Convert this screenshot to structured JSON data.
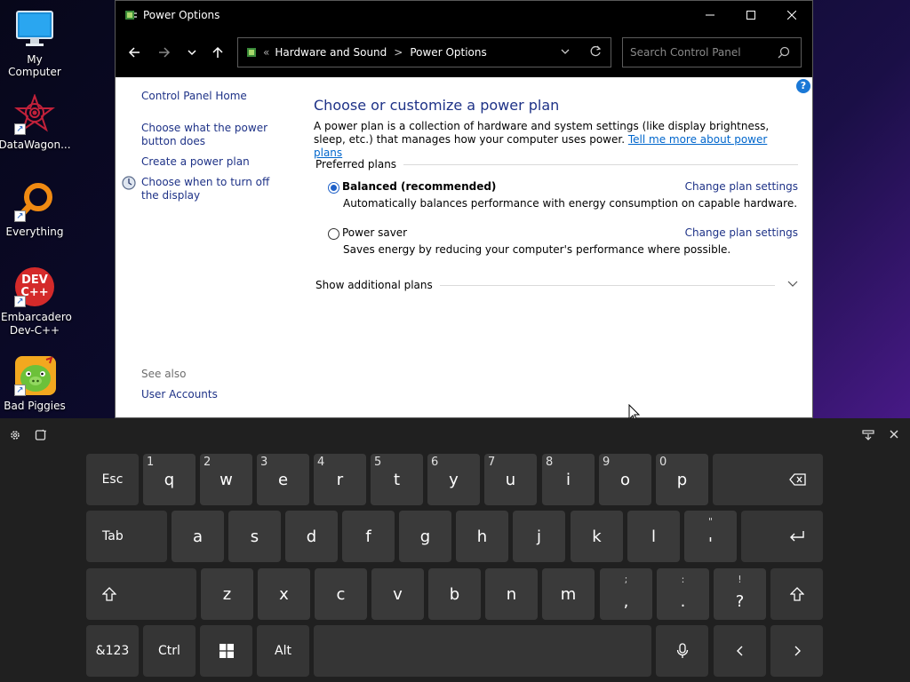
{
  "desktop": {
    "icons": [
      {
        "label": "My Computer",
        "icon": "monitor-icon"
      },
      {
        "label": "DataWagon...",
        "icon": "datawagon-icon"
      },
      {
        "label": "Everything",
        "icon": "everything-icon"
      },
      {
        "label": "Embarcadero Dev-C++",
        "icon": "devcpp-icon",
        "badge": "DEV C++"
      },
      {
        "label": "Bad Piggies",
        "icon": "bad-piggies-icon"
      }
    ]
  },
  "window": {
    "title": "Power Options",
    "breadcrumb": {
      "overflow": "«",
      "items": [
        "Hardware and Sound",
        "Power Options"
      ],
      "separator": ">"
    },
    "search_placeholder": "Search Control Panel",
    "left_pane": {
      "home": "Control Panel Home",
      "links": [
        "Choose what the power button does",
        "Create a power plan",
        "Choose when to turn off the display"
      ],
      "see_also_label": "See also",
      "see_also_links": [
        "User Accounts"
      ]
    },
    "main": {
      "heading": "Choose or customize a power plan",
      "description": "A power plan is a collection of hardware and system settings (like display brightness, sleep, etc.) that manages how your computer uses power.",
      "learn_more": "Tell me more about power plans",
      "preferred_label": "Preferred plans",
      "plans": [
        {
          "name": "Balanced (recommended)",
          "selected": true,
          "description": "Automatically balances performance with energy consumption on capable hardware.",
          "link": "Change plan settings"
        },
        {
          "name": "Power saver",
          "selected": false,
          "description": "Saves energy by reducing your computer's performance where possible.",
          "link": "Change plan settings"
        }
      ],
      "show_additional": "Show additional plans",
      "help": "?"
    }
  },
  "keyboard": {
    "rows": [
      [
        {
          "label": "Esc",
          "fn": true
        },
        {
          "label": "q",
          "num": "1"
        },
        {
          "label": "w",
          "num": "2"
        },
        {
          "label": "e",
          "num": "3"
        },
        {
          "label": "r",
          "num": "4"
        },
        {
          "label": "t",
          "num": "5"
        },
        {
          "label": "y",
          "num": "6"
        },
        {
          "label": "u",
          "num": "7"
        },
        {
          "label": "i",
          "num": "8"
        },
        {
          "label": "o",
          "num": "9"
        },
        {
          "label": "p",
          "num": "0"
        },
        {
          "label": "⌫",
          "fn": true
        }
      ],
      [
        {
          "label": "Tab",
          "fn": true
        },
        {
          "label": "a"
        },
        {
          "label": "s"
        },
        {
          "label": "d"
        },
        {
          "label": "f"
        },
        {
          "label": "g"
        },
        {
          "label": "h"
        },
        {
          "label": "j"
        },
        {
          "label": "k"
        },
        {
          "label": "l"
        },
        {
          "label": "'",
          "sec": "\""
        },
        {
          "label": "↵",
          "fn": true
        }
      ],
      [
        {
          "label": "⇧",
          "fn": true
        },
        {
          "label": "z"
        },
        {
          "label": "x"
        },
        {
          "label": "c"
        },
        {
          "label": "v"
        },
        {
          "label": "b"
        },
        {
          "label": "n"
        },
        {
          "label": "m"
        },
        {
          "label": ",",
          "sec": ";"
        },
        {
          "label": ".",
          "sec": ":"
        },
        {
          "label": "?",
          "sec": "!"
        },
        {
          "label": "⇧",
          "fn": true
        }
      ],
      [
        {
          "label": "&123",
          "fn": true
        },
        {
          "label": "Ctrl",
          "fn": true
        },
        {
          "label": "⊞",
          "fn": true,
          "icon": "windows-icon"
        },
        {
          "label": "Alt",
          "fn": true
        },
        {
          "label": "",
          "fn": true,
          "icon": "space-bar"
        },
        {
          "label": "🎤",
          "fn": true,
          "icon": "mic-icon"
        },
        {
          "label": "‹",
          "fn": true
        },
        {
          "label": "›",
          "fn": true
        }
      ]
    ]
  },
  "colors": {
    "link": "#1e3287",
    "accent": "#1e60c8",
    "keyboard_bg": "#202020",
    "key_bg": "#3a3a3a"
  }
}
